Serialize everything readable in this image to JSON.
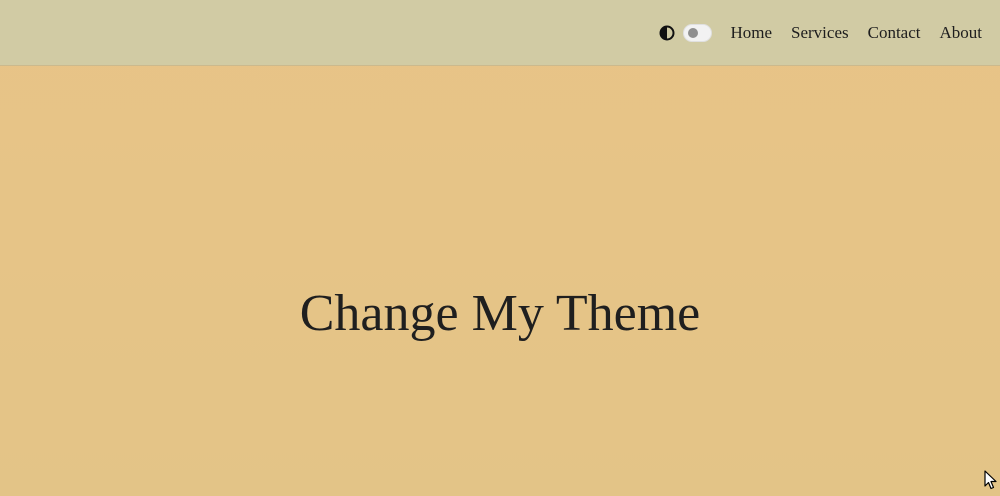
{
  "navbar": {
    "theme_toggle_icon": "contrast-icon",
    "theme_toggle_state": "off",
    "links": [
      {
        "label": "Home"
      },
      {
        "label": "Services"
      },
      {
        "label": "Contact"
      },
      {
        "label": "About"
      }
    ]
  },
  "hero": {
    "title": "Change My Theme"
  },
  "colors": {
    "navbar_bg": "#d1cba4",
    "page_bg": "#e6c487",
    "text": "#1f1f1f",
    "toggle_track": "#f2f2f2",
    "toggle_knob": "#8f8f8f"
  },
  "cursor_icon": "pointer-arrow-icon"
}
